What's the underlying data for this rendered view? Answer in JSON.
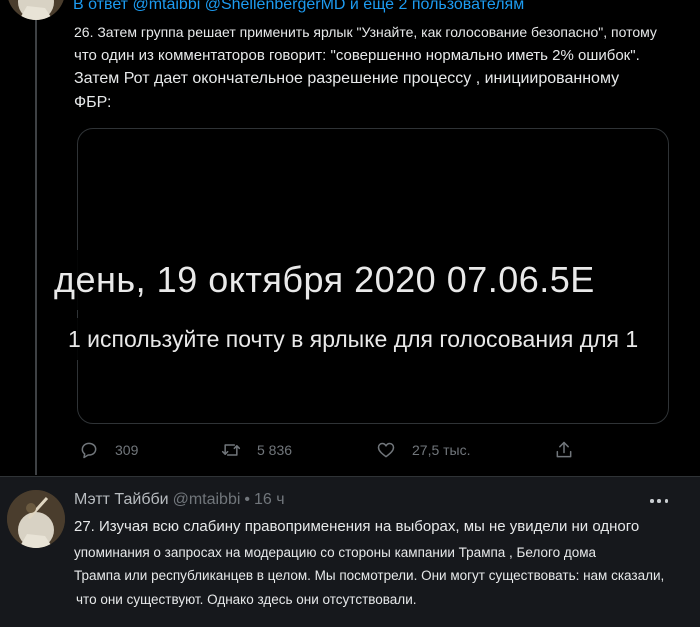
{
  "tweet1": {
    "reply_line": "В ответ @mtaibbi @ShellenbergerMD и еще 2 пользователям",
    "text_lines": [
      "26. Затем группа решает применить ярлык \"Узнайте, как голосование безопасно\", потому",
      "что один из комментаторов говорит: \"совершенно нормально иметь 2% ошибок\".",
      "Затем Рот дает окончательное разрешение процессу , инициированному",
      "ФБР:"
    ],
    "media": {
      "subtitle_date": "день, 19 октября 2020 07.06.5E",
      "subtitle_line": "1 используйте почту в ярлыке для голосования для 1"
    },
    "actions": {
      "replies": "309",
      "retweets": "5 836",
      "likes": "27,5 тыс."
    }
  },
  "tweet2": {
    "author_name": "Мэтт Тайбби",
    "handle": "@mtaibbi",
    "separator": "•",
    "time": "16 ч",
    "text_lines": [
      "27. Изучая всю слабину правоприменения на выборах, мы не увидели ни одного",
      "упоминания о запросах на модерацию со стороны кампании Трампа , Белого дома",
      "Трампа или республиканцев в целом. Мы посмотрели. Они могут существовать: нам сказали,",
      "что они существуют. Однако здесь они отсутствовали."
    ]
  },
  "icons": {
    "reply": "reply-icon",
    "retweet": "retweet-icon",
    "like": "heart-icon",
    "share": "share-icon",
    "more": "more-icon"
  },
  "colors": {
    "background": "#000000",
    "link": "#1d9bf0",
    "text": "#e7e9ea",
    "muted": "#71767b",
    "card": "#16181c"
  }
}
